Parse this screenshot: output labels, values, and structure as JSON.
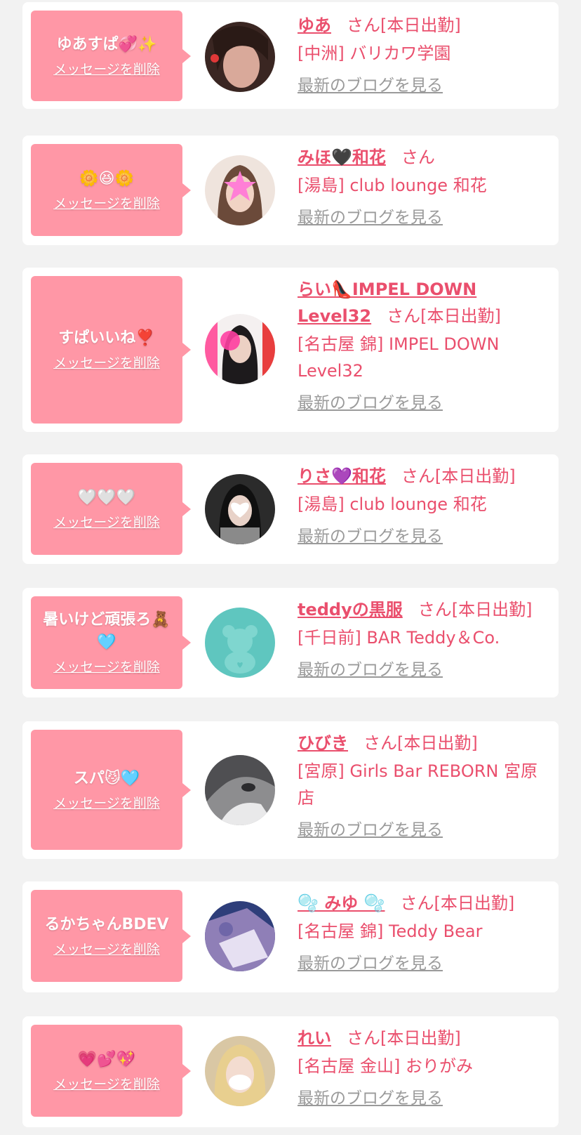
{
  "colors": {
    "background": "#f2f2f2",
    "card": "#ffffff",
    "bubble": "#ff97a6",
    "accent": "#ea4f6d",
    "link_gray": "#9a9a9a"
  },
  "common": {
    "delete_label": "メッセージを削除",
    "blog_label": "最新のブログを見る",
    "san_label": "さん",
    "working_today_label": "[本日出勤]"
  },
  "entries": [
    {
      "message": "ゆあすぱ💞✨",
      "name": "ゆあ",
      "shop": "[中洲] バリカワ学園",
      "working_today": true
    },
    {
      "message": "🌼😆🌼",
      "name": "みほ🖤和花",
      "shop": "[湯島] club lounge 和花",
      "working_today": false
    },
    {
      "message": "すぱいいね❣️",
      "name": "らい👠IMPEL DOWN Level32",
      "shop": "[名古屋 錦] IMPEL DOWN Level32",
      "working_today": true
    },
    {
      "message": "🤍🤍🤍",
      "name": "りさ💜和花",
      "shop": "[湯島] club lounge 和花",
      "working_today": true
    },
    {
      "message": "暑いけど頑張ろ🧸🩵",
      "name": "teddyの黒服",
      "shop": "[千日前] BAR Teddy＆Co.",
      "working_today": true
    },
    {
      "message": "スパ😼🩵",
      "name": "ひびき",
      "shop": "[宮原] Girls Bar REBORN 宮原店",
      "working_today": true
    },
    {
      "message": "るかちゃんBDEV",
      "name": "🫧 みゆ 🫧",
      "shop": "[名古屋 錦] Teddy Bear",
      "working_today": true
    },
    {
      "message": "💗💕💖",
      "name": "れい",
      "shop": "[名古屋 金山] おりがみ",
      "working_today": true
    }
  ]
}
